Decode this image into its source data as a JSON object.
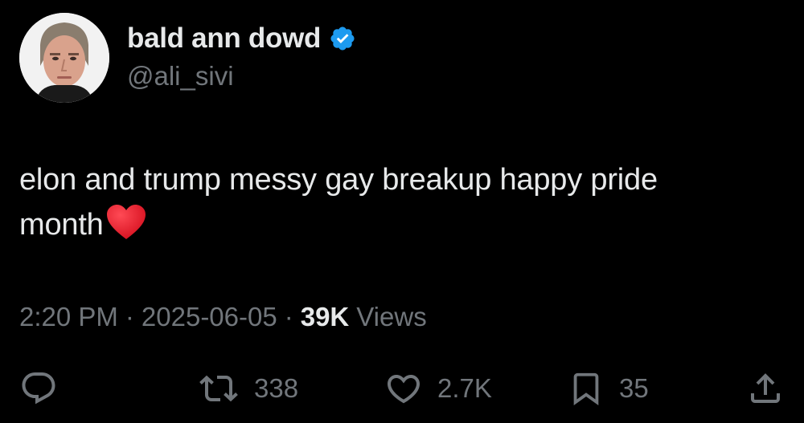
{
  "author": {
    "display_name": "bald ann dowd",
    "handle": "@ali_sivi",
    "verified": true
  },
  "tweet": {
    "text_line1": "elon and trump messy gay breakup happy pride",
    "text_line2": "month",
    "emoji": "red-heart"
  },
  "meta": {
    "time": "2:20 PM",
    "separator": "·",
    "date": "2025-06-05",
    "views_count": "39K",
    "views_label": "Views"
  },
  "actions": {
    "reply": {
      "icon": "reply-icon",
      "count": ""
    },
    "retweet": {
      "icon": "retweet-icon",
      "count": "338"
    },
    "like": {
      "icon": "heart-icon",
      "count": "2.7K"
    },
    "bookmark": {
      "icon": "bookmark-icon",
      "count": "35"
    },
    "share": {
      "icon": "share-icon",
      "count": ""
    }
  },
  "colors": {
    "background": "#000000",
    "primary_text": "#e7e9ea",
    "secondary_text": "#71767b",
    "verified_blue": "#1d9bf0",
    "heart_red": "#e0202e"
  }
}
